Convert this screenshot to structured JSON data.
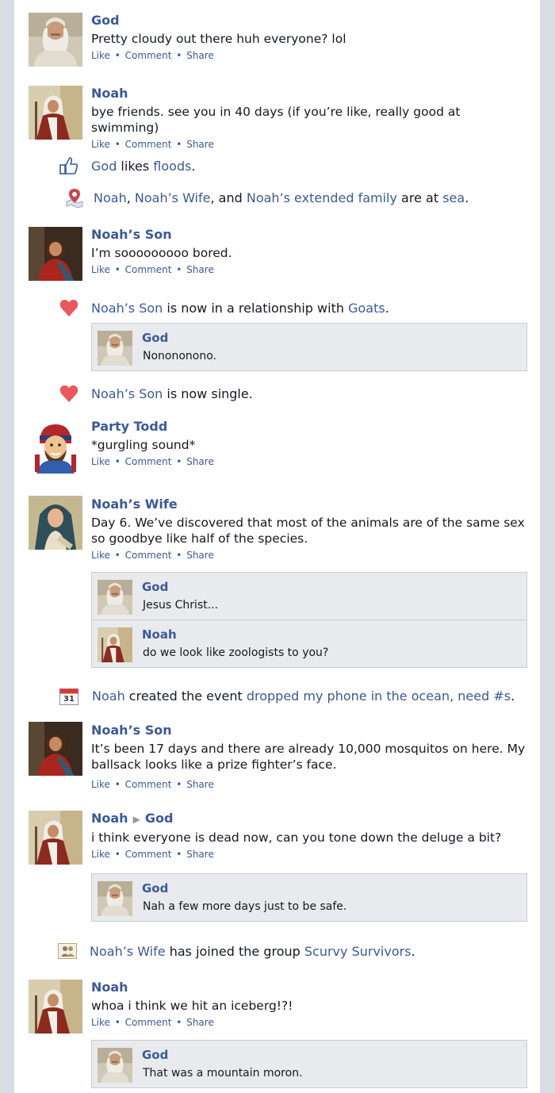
{
  "posts": [
    {
      "author": "God",
      "text": "Pretty cloudy out there huh everyone? lol"
    },
    {
      "author": "Noah",
      "text": "bye friends. see you in 40 days (if you’re like, really good at swimming)"
    },
    {
      "author": "Noah’s Son",
      "text": "I’m sooooooooo bored."
    },
    {
      "author": "Party Todd",
      "text": "*gurgling sound*"
    },
    {
      "author": "Noah’s Wife",
      "text": "Day 6. We’ve discovered that most of the animals are of the same sex so goodbye like half of the species."
    },
    {
      "author": "Noah’s Son",
      "text": "It’s been 17 days and there are already 10,000 mosquitos on here. My ballsack looks like a prize fighter’s face."
    },
    {
      "author": "Noah",
      "target": "God",
      "text": "i think everyone is dead now, can you tone down the deluge a bit?"
    },
    {
      "author": "Noah",
      "text": "whoa i think we hit an iceberg!?!"
    }
  ],
  "actions": {
    "like": "Like",
    "comment": "Comment",
    "share": "Share",
    "separator": "•"
  },
  "stories": {
    "like_story": {
      "actor": "God",
      "verb": " likes ",
      "object": "floods",
      "end": "."
    },
    "checkin": {
      "p1": "Noah",
      "s1": ", ",
      "p2": "Noah’s Wife",
      "s2": ", and ",
      "p3": "Noah’s extended family",
      "s3": " are at ",
      "place": "sea",
      "end": "."
    },
    "relationship": {
      "actor": "Noah’s Son",
      "verb": " is now in a relationship with ",
      "object": "Goats",
      "end": "."
    },
    "single": {
      "actor": "Noah’s Son",
      "verb": " is now single."
    },
    "event": {
      "actor": "Noah",
      "verb": " created the event ",
      "object": "dropped my phone in the ocean, need #s",
      "end": ".",
      "calendar_day": "31"
    },
    "group": {
      "actor": "Noah’s Wife",
      "verb": " has joined the group ",
      "object": "Scurvy Survivors",
      "end": "."
    }
  },
  "comments": {
    "relationship": [
      {
        "author": "God",
        "text": "Nonononono."
      }
    ],
    "wife_post": [
      {
        "author": "God",
        "text": "Jesus Christ..."
      },
      {
        "author": "Noah",
        "text": "do we look like zoologists to you?"
      }
    ],
    "noah_god_post": [
      {
        "author": "God",
        "text": "Nah a few more days just to be safe."
      }
    ],
    "iceberg_post": [
      {
        "author": "God",
        "text": "That was a mountain moron."
      }
    ]
  },
  "colors": {
    "link": "#3b5998",
    "text": "#141823",
    "heart": "#e9585c",
    "comment_bg": "#e9eaed",
    "page_bg": "#d8dce3"
  }
}
